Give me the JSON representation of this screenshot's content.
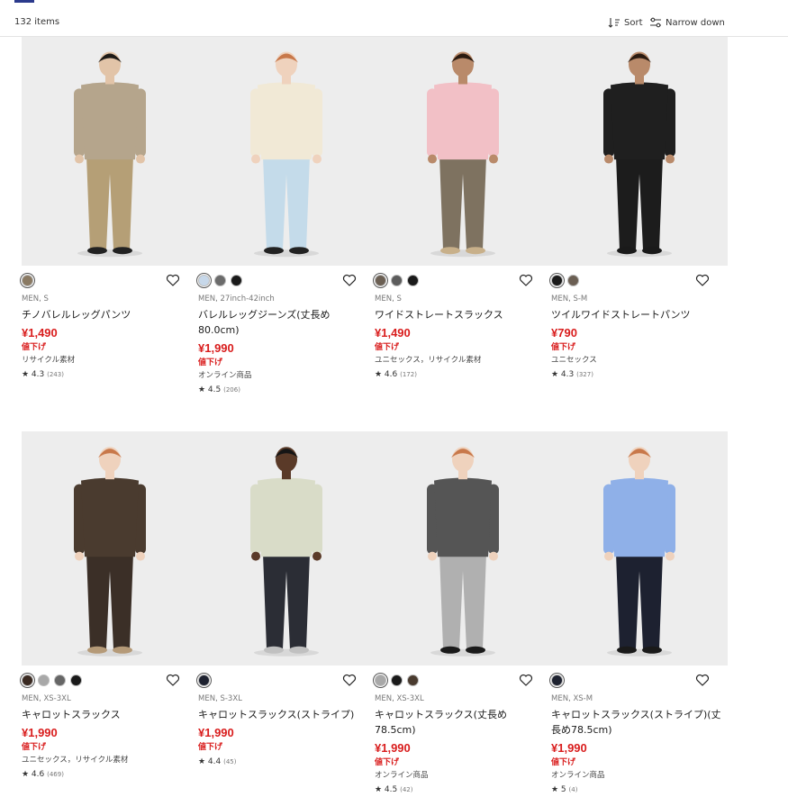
{
  "header": {
    "item_count": "132 items",
    "sort_label": "Sort",
    "narrow_label": "Narrow down",
    "sort_icon": "sort-icon",
    "filter_icon": "filter-sliders-icon"
  },
  "products": [
    {
      "size": "MEN, S",
      "name": "チノバレルレッグパンツ",
      "price": "¥1,490",
      "tag": "値下げ",
      "note": "リサイクル素材",
      "rating": "★ 4.3",
      "reviews": "(243)",
      "colors": [
        "#8a7a63"
      ],
      "top_color": "#b5a58c",
      "bottom_color": "#b59f76",
      "shoe_color": "#222222",
      "hair_color": "#1e1a17",
      "skin_color": "#e2c4a8"
    },
    {
      "size": "MEN, 27inch-42inch",
      "name": "バレルレッグジーンズ(丈長め80.0cm)",
      "price": "¥1,990",
      "tag": "値下げ",
      "note": "オンライン商品",
      "rating": "★ 4.5",
      "reviews": "(206)",
      "colors": [
        "#c7d8ea",
        "#6b6b6b",
        "#1a1a1a"
      ],
      "top_color": "#f1e9d6",
      "bottom_color": "#c4dbea",
      "shoe_color": "#222222",
      "hair_color": "#c8784a",
      "skin_color": "#efd2bd"
    },
    {
      "size": "MEN, S",
      "name": "ワイドストレートスラックス",
      "price": "¥1,490",
      "tag": "値下げ",
      "note": "ユニセックス，リサイクル素材",
      "rating": "★ 4.6",
      "reviews": "(172)",
      "colors": [
        "#6b5f53",
        "#5c5c5c",
        "#1a1a1a"
      ],
      "top_color": "#f2c0c6",
      "bottom_color": "#7e7260",
      "shoe_color": "#c8b08a",
      "hair_color": "#2a1a10",
      "skin_color": "#b98a6a"
    },
    {
      "size": "MEN, S-M",
      "name": "ツイルワイドストレートパンツ",
      "price": "¥790",
      "tag": "値下げ",
      "note": "ユニセックス",
      "rating": "★ 4.3",
      "reviews": "(327)",
      "colors": [
        "#1a1a1a",
        "#6b5f53"
      ],
      "top_color": "#1f1f1f",
      "bottom_color": "#1c1c1c",
      "shoe_color": "#1a1a1a",
      "hair_color": "#2a1a10",
      "skin_color": "#b98a6a"
    },
    {
      "size": "MEN, XS-3XL",
      "name": "キャロットスラックス",
      "price": "¥1,990",
      "tag": "値下げ",
      "note": "ユニセックス，リサイクル素材",
      "rating": "★ 4.6",
      "reviews": "(469)",
      "colors": [
        "#3a2a22",
        "#a8a8a8",
        "#666666",
        "#1a1a1a"
      ],
      "top_color": "#4a3b2f",
      "bottom_color": "#3b2f27",
      "shoe_color": "#b59a78",
      "hair_color": "#c8784a",
      "skin_color": "#efd2bd"
    },
    {
      "size": "MEN, S-3XL",
      "name": "キャロットスラックス(ストライプ)",
      "price": "¥1,990",
      "tag": "値下げ",
      "note": "",
      "rating": "★ 4.4",
      "reviews": "(45)",
      "colors": [
        "#1e2230"
      ],
      "top_color": "#d9dcc8",
      "bottom_color": "#2b2d35",
      "shoe_color": "#c0c0c0",
      "hair_color": "#151515",
      "skin_color": "#5a3a28"
    },
    {
      "size": "MEN, XS-3XL",
      "name": "キャロットスラックス(丈長め78.5cm)",
      "price": "¥1,990",
      "tag": "値下げ",
      "note": "オンライン商品",
      "rating": "★ 4.5",
      "reviews": "(42)",
      "colors": [
        "#a8a8a8",
        "#1a1a1a",
        "#4a3b2f"
      ],
      "top_color": "#555555",
      "bottom_color": "#b0b0b0",
      "shoe_color": "#1a1a1a",
      "hair_color": "#c8784a",
      "skin_color": "#efd2bd"
    },
    {
      "size": "MEN, XS-M",
      "name": "キャロットスラックス(ストライプ)(丈長め78.5cm)",
      "price": "¥1,990",
      "tag": "値下げ",
      "note": "オンライン商品",
      "rating": "★ 5",
      "reviews": "(4)",
      "colors": [
        "#1e2230"
      ],
      "top_color": "#8fb0e8",
      "bottom_color": "#1d2130",
      "shoe_color": "#1a1a1a",
      "hair_color": "#c8784a",
      "skin_color": "#efd2bd"
    }
  ]
}
